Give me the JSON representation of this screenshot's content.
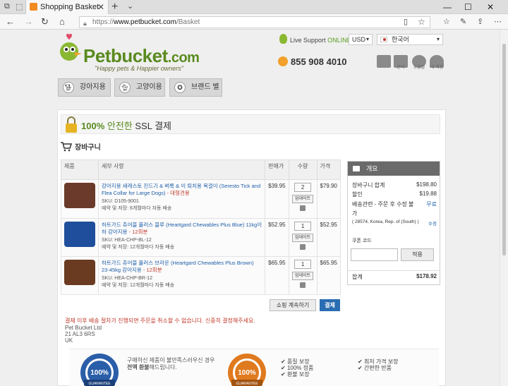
{
  "browser": {
    "tab_title": "Shopping Basket",
    "url_scheme": "https://",
    "url_host": "www.petbucket.com",
    "url_path": "/Basket"
  },
  "header": {
    "logo_main": "Petbucket",
    "logo_domain": ".com",
    "slogan": "\"Happy pets & Happier owners\"",
    "live_support": "Live Support",
    "online": "ONLINE",
    "currency": "USD",
    "language": "한국어",
    "phone": "855 908 4010",
    "icon_labels": [
      "",
      "문의",
      "도움말",
      "내 계정"
    ]
  },
  "categories": [
    "강아지용",
    "고양이용",
    "브랜드 별"
  ],
  "ssl": {
    "pct": "100%",
    "word": "안전한",
    "rest": "SSL 결제"
  },
  "cart": {
    "title": "장바구니",
    "headers": [
      "제품",
      "세부 사항",
      "판매가",
      "수량",
      "가격"
    ],
    "items": [
      {
        "name": "강아지용 세레스토 진드기 & 벼룩 & 이 퇴치용 목걸이 (Seresto Tick and Flea Collar for Large Dogs)",
        "suffix": " - 대형견용",
        "sku": "SKU: D105-9001",
        "delivery": "예약 및 저장: 6개월마다 자동 배송",
        "price": "$39.95",
        "qty": "2",
        "total": "$79.90",
        "update": "업데이트",
        "img_color": "#6b3a2a"
      },
      {
        "name": "하트가드 츄어블 플러스 블루 (Heartgard Chewables Plus Blue) 11kg이하 강아지용",
        "suffix": " - 12회분",
        "sku": "SKU: HEA-CHP-BL-12",
        "delivery": "예약 및 저장: 12개월마다 자동 배송",
        "price": "$52.95",
        "qty": "1",
        "total": "$52.95",
        "update": "업데이트",
        "img_color": "#1f4f9c"
      },
      {
        "name": "하트가드 츄어블 플러스 브라운 (Heartgard Chewables Plus Brown) 23-45kg 강아지용",
        "suffix": " - 12회분",
        "sku": "SKU: HEA-CHP-BR-12",
        "delivery": "예약 및 저장: 12개월마다 자동 배송",
        "price": "$65.95",
        "qty": "1",
        "total": "$65.95",
        "update": "업데이트",
        "img_color": "#6a3b20"
      }
    ],
    "continue_label": "쇼핑 계속하기",
    "checkout_label": "결제"
  },
  "summary": {
    "title": "개요",
    "subtotal_label": "장바구니 합계",
    "subtotal": "$198.80",
    "discount_label": "할인",
    "discount": "$19.88",
    "shipping_label": "배송관련 - 주문 후 수정 불가",
    "shipping": "무료",
    "address": "( 28574, Korea, Rep. of (South) )",
    "address_edit": "수정",
    "coupon_label": "쿠폰 코드",
    "coupon_placeholder": "",
    "apply_label": "적용",
    "total_label": "합계",
    "total": "$178.92"
  },
  "notice": "결제 이후 배송 절차가 진행되면 주문을 취소할 수 없습니다. 신중히 결정해주세요.",
  "company": [
    "Pet Bucket Ltd",
    "21 AL3 6RS",
    "UK"
  ],
  "guarantee": {
    "line1": "구매하신 제품이 불만족스러우신 경우",
    "line2a": "전액 환불",
    "line2b": "해드립니다.",
    "badge_text": "100%",
    "badge_sub": "GUARANTEE",
    "features_left": [
      "품질 보장",
      "100% 정품",
      "환불 보장"
    ],
    "features_right": [
      "최저 가격 보장",
      "간편한 반품"
    ]
  },
  "colors": {
    "brand_green": "#5a8a1f",
    "link_blue": "#1f5fa8",
    "alert_red": "#c0392b",
    "pay_blue": "#2a6db2"
  }
}
